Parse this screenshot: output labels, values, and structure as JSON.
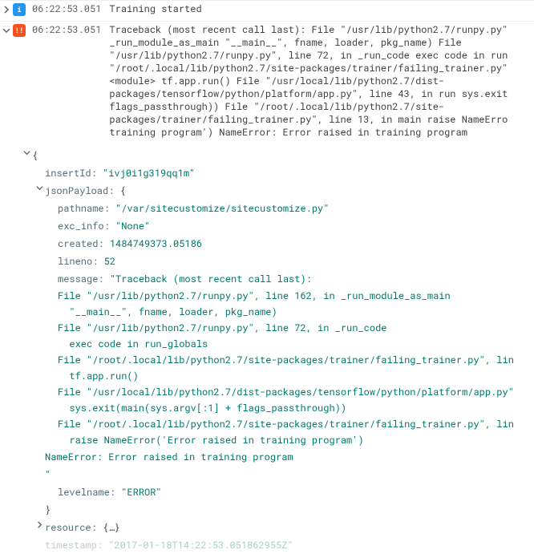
{
  "rows": [
    {
      "severity": "i",
      "sev_class": "sev-info",
      "expanded": false,
      "timestamp": "06:22:53.051",
      "message": "Training started"
    },
    {
      "severity": "!!",
      "sev_class": "sev-error",
      "expanded": true,
      "timestamp": "06:22:53.051",
      "message": "Traceback (most recent call last): File \"/usr/lib/python2.7/runpy.py\"\n_run_module_as_main \"__main__\", fname, loader, pkg_name) File\n\"/usr/lib/python2.7/runpy.py\", line 72, in _run_code exec code in run\n\"/root/.local/lib/python2.7/site-packages/trainer/failing_trainer.py\"\n<module> tf.app.run() File \"/usr/local/lib/python2.7/dist-\npackages/tensorflow/python/platform/app.py\", line 43, in run sys.exit\nflags_passthrough)) File \"/root/.local/lib/python2.7/site-\npackages/trainer/failing_trainer.py\", line 13, in main raise NameErro\ntraining program') NameError: Error raised in training program"
    }
  ],
  "payload": {
    "open_brace": "{",
    "close_brace": "}",
    "insertId": {
      "key": "insertId:",
      "value": "\"ivj0i1g319qq1m\""
    },
    "jsonPayload": {
      "key": "jsonPayload:",
      "open": "{",
      "close": "}",
      "pathname": {
        "key": "pathname:",
        "value": "\"/var/sitecustomize/sitecustomize.py\""
      },
      "exc_info": {
        "key": "exc_info:",
        "value": "\"None\""
      },
      "created": {
        "key": "created:",
        "value": "1484749373.05186"
      },
      "lineno": {
        "key": "lineno:",
        "value": "52"
      },
      "message_key": "message:",
      "message_first": "\"Traceback (most recent call last):",
      "trace": [
        "File \"/usr/lib/python2.7/runpy.py\", line 162, in _run_module_as_main",
        "  \"__main__\", fname, loader, pkg_name)",
        "File \"/usr/lib/python2.7/runpy.py\", line 72, in _run_code",
        "  exec code in run_globals",
        "File \"/root/.local/lib/python2.7/site-packages/trainer/failing_trainer.py\", lin",
        "  tf.app.run()",
        "File \"/usr/local/lib/python2.7/dist-packages/tensorflow/python/platform/app.py\"",
        "  sys.exit(main(sys.argv[:1] + flags_passthrough))",
        "File \"/root/.local/lib/python2.7/site-packages/trainer/failing_trainer.py\", lin",
        "  raise NameError('Error raised in training program')"
      ],
      "message_tail1": "NameError: Error raised in training program",
      "message_tail2": "\"",
      "levelname": {
        "key": "levelname:",
        "value": "\"ERROR\""
      }
    },
    "resource": {
      "key": "resource:",
      "value": "{…}"
    },
    "timestamp_field": {
      "key": "timestamp:",
      "value": "\"2017-01-18T14:22:53.051862955Z\""
    }
  }
}
